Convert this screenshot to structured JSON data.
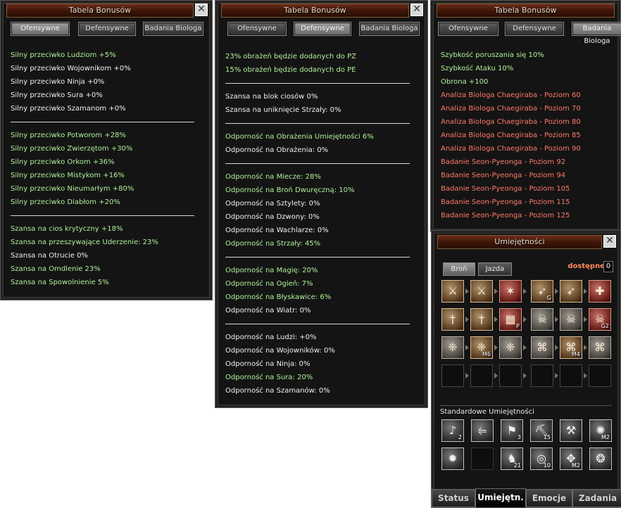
{
  "panel1": {
    "title": "Tabela Bonusów",
    "tabs": [
      "Ofensywne",
      "Defensywne",
      "Badania Biologa"
    ],
    "groups": [
      [
        {
          "text": "Silny przeciwko Ludziom +5%",
          "color": "green"
        },
        {
          "text": "Silny przeciwko Wojownikom +0%",
          "color": "white"
        },
        {
          "text": "Silny przeciwko Ninja +0%",
          "color": "white"
        },
        {
          "text": "Silny przeciwko Sura +0%",
          "color": "white"
        },
        {
          "text": "Silny przeciwko Szamanom +0%",
          "color": "white"
        }
      ],
      [
        {
          "text": "Silny przeciwko Potworom +28%",
          "color": "green"
        },
        {
          "text": "Silny przeciwko Zwierzętom +30%",
          "color": "green"
        },
        {
          "text": "Silny przeciwko Orkom +36%",
          "color": "green"
        },
        {
          "text": "Silny przeciwko Mistykom +16%",
          "color": "green"
        },
        {
          "text": "Silny przeciwko Nieumarłym +80%",
          "color": "green"
        },
        {
          "text": "Silny przeciwko Diabłom +20%",
          "color": "green"
        }
      ],
      [
        {
          "text": "Szansa na cios krytyczny +18%",
          "color": "green"
        },
        {
          "text": "Szansa na przeszywające Uderzenie: 23%",
          "color": "green"
        },
        {
          "text": "Szansa na Otrucie 0%",
          "color": "white"
        },
        {
          "text": "Szansa na Omdlenie 23%",
          "color": "green"
        },
        {
          "text": "Szansa na Spowolnienie 5%",
          "color": "green"
        }
      ]
    ]
  },
  "panel2": {
    "title": "Tabela Bonusów",
    "tabs": [
      "Ofensywne",
      "Defensywne",
      "Badania Biologa"
    ],
    "groups": [
      [
        {
          "text": "23% obrażeń będzie dodanych do PZ",
          "color": "green"
        },
        {
          "text": "15% obrażeń będzie dodanych do PE",
          "color": "green"
        }
      ],
      [
        {
          "text": "Szansa na blok ciosów 0%",
          "color": "white"
        },
        {
          "text": "Szansa na uniknięcie Strzały: 0%",
          "color": "white"
        }
      ],
      [
        {
          "text": "Odporność na Obrażenia Umiejętności 6%",
          "color": "green"
        },
        {
          "text": "Odporność na Obrażenia: 0%",
          "color": "white"
        }
      ],
      [
        {
          "text": "Odporność na Miecze: 28%",
          "color": "green"
        },
        {
          "text": "Odporność na Broń Dwuręczną: 10%",
          "color": "green"
        },
        {
          "text": "Odporność na Sztylety: 0%",
          "color": "white"
        },
        {
          "text": "Odporność na Dzwony: 0%",
          "color": "white"
        },
        {
          "text": "Odporność na Wachlarze: 0%",
          "color": "white"
        },
        {
          "text": "Odporność na Strzały: 45%",
          "color": "green"
        }
      ],
      [
        {
          "text": "Odporność na Magię: 20%",
          "color": "green"
        },
        {
          "text": "Odporność na Ogień: 7%",
          "color": "green"
        },
        {
          "text": "Odporność na Błyskawice: 6%",
          "color": "green"
        },
        {
          "text": "Odporność na Wiatr: 0%",
          "color": "white"
        }
      ],
      [
        {
          "text": "Odporność na Ludzi: +0%",
          "color": "white"
        },
        {
          "text": "Odporność na Wojowników: 0%",
          "color": "white"
        },
        {
          "text": "Odporność na Ninja: 0%",
          "color": "white"
        },
        {
          "text": "Odporność na Sura: 20%",
          "color": "green"
        },
        {
          "text": "Odporność na Szamanów: 0%",
          "color": "white"
        }
      ]
    ]
  },
  "panel3": {
    "title": "Tabela Bonusów",
    "tabs": [
      "Ofensywne",
      "Defensywne",
      "Badania Biologa"
    ],
    "lines": [
      {
        "text": "Szybkość poruszania się 10%",
        "color": "green"
      },
      {
        "text": "Szybkość Ataku 10%",
        "color": "green"
      },
      {
        "text": "Obrona +100",
        "color": "green"
      },
      {
        "text": "Analiza Biologa Chaegiraba - Poziom 60",
        "color": "red"
      },
      {
        "text": "Analiza Biologa Chaegiraba - Poziom 70",
        "color": "red"
      },
      {
        "text": "Analiza Biologa Chaegiraba - Poziom 80",
        "color": "red"
      },
      {
        "text": "Analiza Biologa Chaegiraba - Poziom 85",
        "color": "red"
      },
      {
        "text": "Analiza Biologa Chaegiraba - Poziom 90",
        "color": "red"
      },
      {
        "text": "Badanie Seon-Pyeonga - Poziom 92",
        "color": "red"
      },
      {
        "text": "Badanie Seon-Pyeonga - Poziom 94",
        "color": "red"
      },
      {
        "text": "Badanie Seon-Pyeonga - Poziom 105",
        "color": "red"
      },
      {
        "text": "Badanie Seon-Pyeonga - Poziom 115",
        "color": "red"
      },
      {
        "text": "Badanie Seon-Pyeonga - Poziom 125",
        "color": "red"
      }
    ]
  },
  "skills": {
    "title": "Umiejętności",
    "tabs": [
      "Broń",
      "Jazda"
    ],
    "available_label": "dostępne",
    "available_value": "0",
    "section_label": "Standardowe Umiejętności",
    "grid": [
      [
        {
          "style": "filled",
          "icon": "blade-icon",
          "level": ""
        },
        {
          "style": "filled",
          "icon": "blade-icon",
          "level": ""
        },
        {
          "style": "red",
          "icon": "claw-icon",
          "level": ""
        },
        {
          "style": "filled",
          "icon": "feather-icon",
          "level": "G"
        },
        {
          "style": "filled",
          "icon": "feather-icon",
          "level": ""
        },
        {
          "style": "red",
          "icon": "cross-icon",
          "level": ""
        }
      ],
      [
        {
          "style": "filled",
          "icon": "sword-icon",
          "level": ""
        },
        {
          "style": "filled",
          "icon": "sword-icon",
          "level": ""
        },
        {
          "style": "red",
          "icon": "hatch-icon",
          "level": "P"
        },
        {
          "style": "gray",
          "icon": "skull-icon",
          "level": ""
        },
        {
          "style": "gray",
          "icon": "skull-icon",
          "level": ""
        },
        {
          "style": "red",
          "icon": "skull-icon",
          "level": "G2"
        }
      ],
      [
        {
          "style": "gray",
          "icon": "rune-icon",
          "level": ""
        },
        {
          "style": "filled",
          "icon": "rune-icon",
          "level": "M6"
        },
        {
          "style": "gray",
          "icon": "rune-icon",
          "level": ""
        },
        {
          "style": "gray",
          "icon": "glyph-icon",
          "level": ""
        },
        {
          "style": "filled",
          "icon": "glyph-icon",
          "level": "M4"
        },
        {
          "style": "gray",
          "icon": "glyph-icon",
          "level": ""
        }
      ],
      [
        {
          "style": "empty",
          "icon": "",
          "level": ""
        },
        {
          "style": "empty",
          "icon": "",
          "level": ""
        },
        {
          "style": "empty",
          "icon": "",
          "level": ""
        },
        {
          "style": "empty",
          "icon": "",
          "level": ""
        },
        {
          "style": "empty",
          "icon": "",
          "level": ""
        },
        {
          "style": "empty",
          "icon": "",
          "level": ""
        }
      ]
    ],
    "standard": [
      [
        {
          "icon": "horn-icon",
          "level": "2"
        },
        {
          "icon": "fishing-rod-icon",
          "level": ""
        },
        {
          "icon": "flag-icon",
          "level": "3"
        },
        {
          "icon": "pickaxe-icon",
          "level": "15"
        },
        {
          "icon": "hammer-icon",
          "level": ""
        },
        {
          "icon": "crest-icon",
          "level": "M2"
        }
      ],
      [
        {
          "icon": "sun-icon",
          "level": ""
        },
        {
          "icon": "",
          "level": ""
        },
        {
          "icon": "horse-icon",
          "level": "21"
        },
        {
          "icon": "seal-icon",
          "level": "10"
        },
        {
          "icon": "branch-icon",
          "level": "M2"
        },
        {
          "icon": "dragon-icon",
          "level": ""
        }
      ]
    ],
    "bottom_tabs": [
      "Status",
      "Umiejętn.",
      "Emocje",
      "Zadania"
    ]
  },
  "colors": {
    "green": "#aef09a",
    "white": "#f0f0f0",
    "red": "#ff7a6a"
  }
}
